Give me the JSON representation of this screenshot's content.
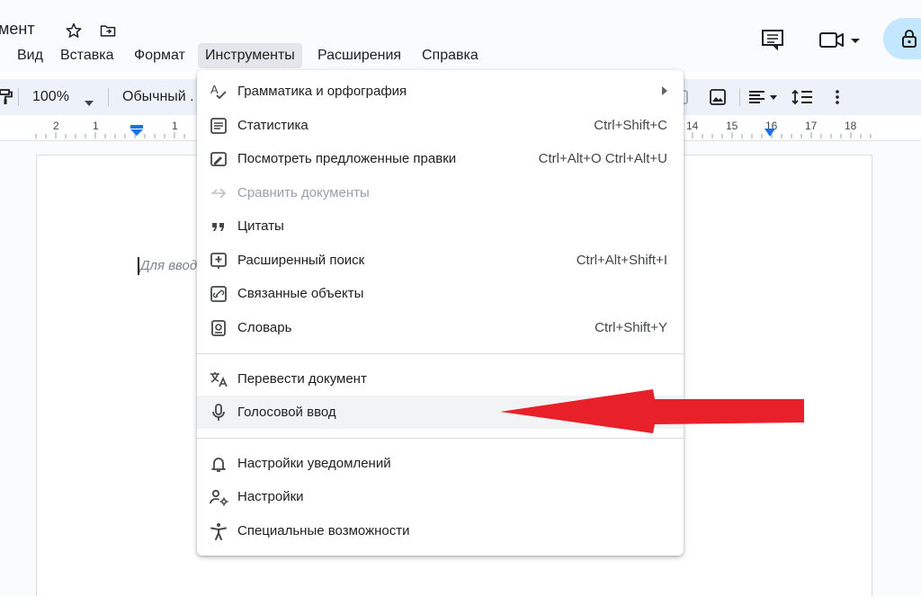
{
  "document": {
    "title": "мент",
    "placeholder": "Для ввод"
  },
  "menubar": [
    {
      "label": "Вид"
    },
    {
      "label": "Вставка"
    },
    {
      "label": "Формат"
    },
    {
      "label": "Инструменты",
      "active": true
    },
    {
      "label": "Расширения"
    },
    {
      "label": "Справка"
    }
  ],
  "toolbar": {
    "zoom": "100%",
    "style": "Обычный ."
  },
  "ruler": {
    "numbers_left": [
      "2",
      "1",
      "1"
    ],
    "numbers_right": [
      "14",
      "15",
      "16",
      "17",
      "18"
    ]
  },
  "tools_menu": {
    "items": [
      {
        "icon": "spellcheck-icon",
        "label": "Грамматика и орфография",
        "shortcut": "",
        "submenu": true,
        "disabled": false
      },
      {
        "icon": "word-count-icon",
        "label": "Статистика",
        "shortcut": "Ctrl+Shift+C",
        "submenu": false,
        "disabled": false
      },
      {
        "icon": "review-edits-icon",
        "label": "Посмотреть предложенные правки",
        "shortcut": "Ctrl+Alt+O Ctrl+Alt+U",
        "submenu": false,
        "disabled": false
      },
      {
        "icon": "compare-icon",
        "label": "Сравнить документы",
        "shortcut": "",
        "submenu": false,
        "disabled": true
      },
      {
        "icon": "quote-icon",
        "label": "Цитаты",
        "shortcut": "",
        "submenu": false,
        "disabled": false
      },
      {
        "icon": "explore-icon",
        "label": "Расширенный поиск",
        "shortcut": "Ctrl+Alt+Shift+I",
        "submenu": false,
        "disabled": false
      },
      {
        "icon": "linked-objects-icon",
        "label": "Связанные объекты",
        "shortcut": "",
        "submenu": false,
        "disabled": false
      },
      {
        "icon": "dictionary-icon",
        "label": "Словарь",
        "shortcut": "Ctrl+Shift+Y",
        "submenu": false,
        "disabled": false
      },
      {
        "icon": "translate-icon",
        "label": "Перевести документ",
        "shortcut": "",
        "submenu": false,
        "disabled": false
      },
      {
        "icon": "microphone-icon",
        "label": "Голосовой ввод",
        "shortcut": "",
        "submenu": false,
        "disabled": false,
        "highlighted": true
      },
      {
        "icon": "bell-icon",
        "label": "Настройки уведомлений",
        "shortcut": "",
        "submenu": false,
        "disabled": false
      },
      {
        "icon": "preferences-icon",
        "label": "Настройки",
        "shortcut": "",
        "submenu": false,
        "disabled": false
      },
      {
        "icon": "accessibility-icon",
        "label": "Специальные возможности",
        "shortcut": "",
        "submenu": false,
        "disabled": false
      }
    ]
  },
  "colors": {
    "accent_blue": "#1a73e8",
    "annotation_arrow": "#e8202a",
    "menu_active_bg": "#e3e6ea",
    "lock_pill": "#c2e7ff"
  }
}
